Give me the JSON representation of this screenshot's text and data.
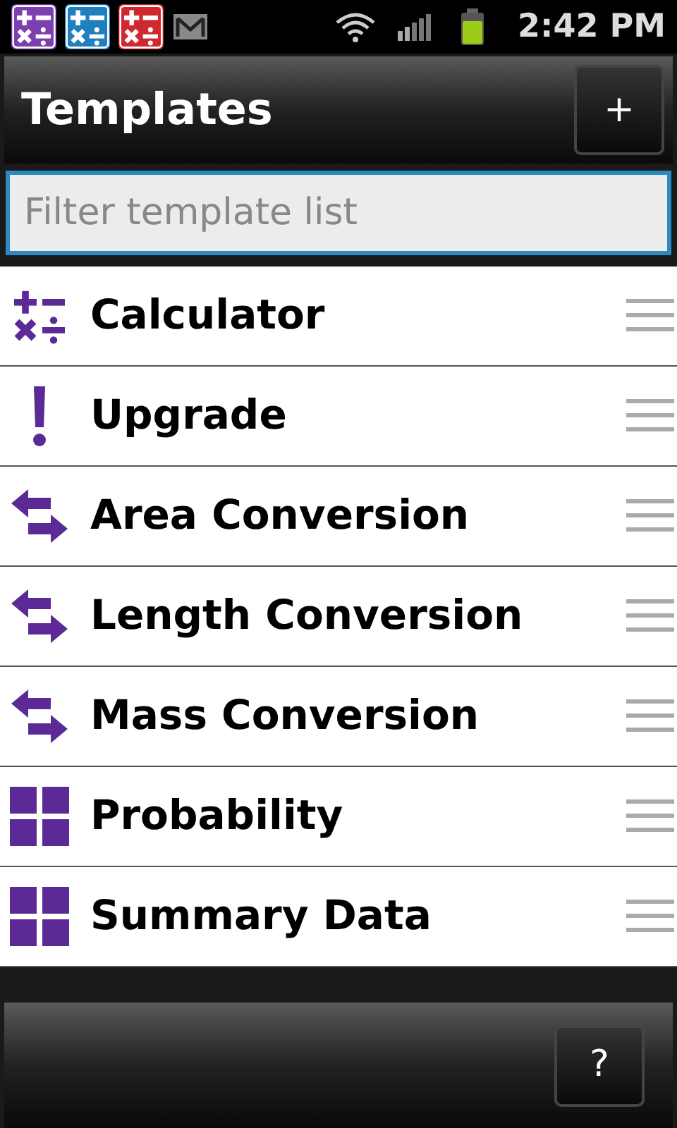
{
  "status_bar": {
    "notifications": [
      {
        "kind": "calculator",
        "color": "#7b3fb0"
      },
      {
        "kind": "calculator",
        "color": "#1f7fbf"
      },
      {
        "kind": "calculator",
        "color": "#d0282f"
      },
      {
        "kind": "mail"
      }
    ],
    "time": "2:42 PM"
  },
  "action_bar": {
    "title": "Templates",
    "add_button": "+"
  },
  "filter": {
    "placeholder": "Filter template list"
  },
  "templates": [
    {
      "label": "Calculator",
      "kind": "calculator"
    },
    {
      "label": "Upgrade",
      "kind": "alert"
    },
    {
      "label": "Area Conversion",
      "kind": "conversion"
    },
    {
      "label": "Length Conversion",
      "kind": "conversion"
    },
    {
      "label": "Mass Conversion",
      "kind": "conversion"
    },
    {
      "label": "Probability",
      "kind": "grid"
    },
    {
      "label": "Summary Data",
      "kind": "grid"
    }
  ],
  "bottom_bar": {
    "help_button": "?"
  }
}
